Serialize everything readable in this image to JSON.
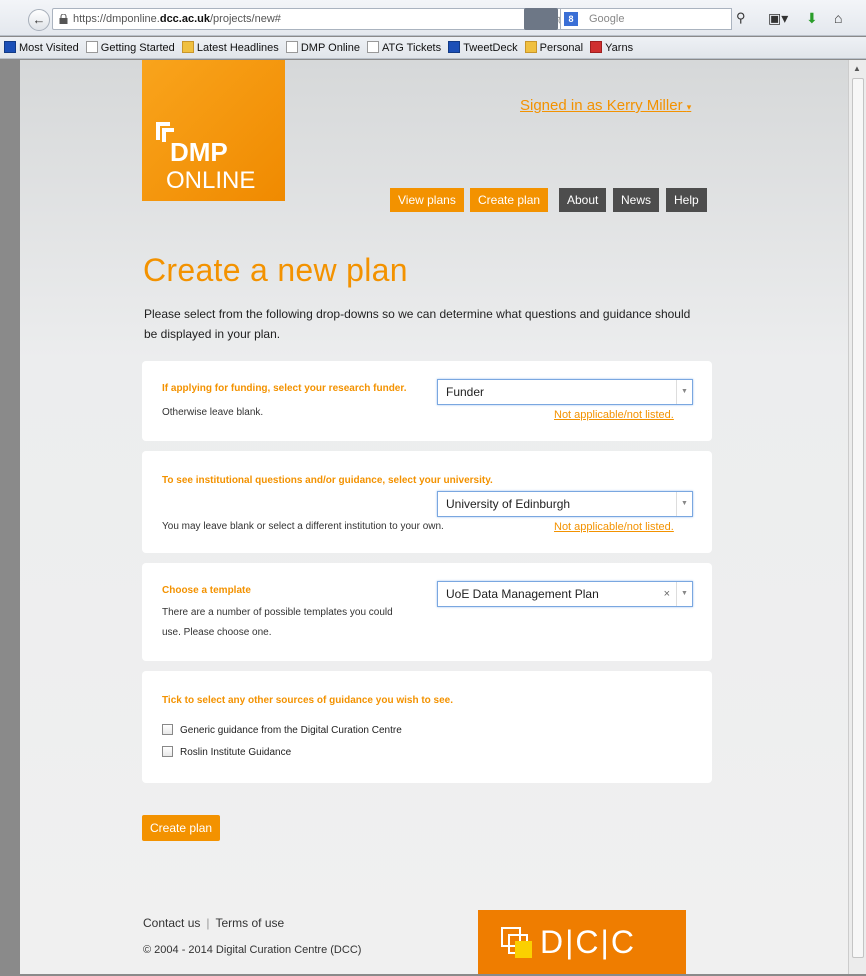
{
  "browser": {
    "url_prefix": "https://dmponline.",
    "url_host": "dcc.ac.uk",
    "url_path": "/projects/new#",
    "search_placeholder": "Google",
    "search_engine_badge": "8",
    "bookmarks": [
      {
        "label": "Most Visited",
        "icon": "firefox-icon"
      },
      {
        "label": "Getting Started",
        "icon": "page-icon"
      },
      {
        "label": "Latest Headlines",
        "icon": "rss-folder-icon"
      },
      {
        "label": "DMP Online",
        "icon": "page-icon"
      },
      {
        "label": "ATG Tickets",
        "icon": "page-icon"
      },
      {
        "label": "TweetDeck",
        "icon": "tweetdeck-icon"
      },
      {
        "label": "Personal",
        "icon": "folder-icon"
      },
      {
        "label": "Yarns",
        "icon": "cart-icon"
      }
    ]
  },
  "header": {
    "logo_top": "DMP",
    "logo_bottom": "ONLINE",
    "signed_in": "Signed in as Kerry Miller",
    "nav": [
      {
        "label": "View plans",
        "style": "orange"
      },
      {
        "label": "Create plan",
        "style": "orange"
      },
      {
        "label": "About",
        "style": "grey"
      },
      {
        "label": "News",
        "style": "grey"
      },
      {
        "label": "Help",
        "style": "grey"
      }
    ]
  },
  "main": {
    "title": "Create a new plan",
    "intro": "Please select from the following drop-downs so we can determine what questions and guidance should be displayed in your plan.",
    "funder": {
      "label": "If applying for funding, select your research funder.",
      "help": "Otherwise leave blank.",
      "value": "Funder",
      "na_link": "Not applicable/not listed."
    },
    "institution": {
      "label": "To see institutional questions and/or guidance, select your university.",
      "help": "You may leave blank or select a different institution to your own.",
      "value": "University of Edinburgh",
      "na_link": "Not applicable/not listed."
    },
    "template": {
      "label": "Choose a template",
      "help_line1": "There are a number of possible templates you could",
      "help_line2": "use. Please choose one.",
      "value": "UoE Data Management Plan"
    },
    "guidance": {
      "label": "Tick to select any other sources of guidance you wish to see.",
      "options": [
        {
          "label": "Generic guidance from the Digital Curation Centre",
          "checked": false
        },
        {
          "label": "Roslin Institute Guidance",
          "checked": false
        }
      ]
    },
    "submit_label": "Create plan"
  },
  "footer": {
    "contact": "Contact us",
    "terms": "Terms of use",
    "copyright": "© 2004 - 2014 Digital Curation Centre (DCC)",
    "dcc_logo": "D|C|C"
  },
  "colors": {
    "accent": "#f39200",
    "nav_grey": "#4d4d4d"
  }
}
